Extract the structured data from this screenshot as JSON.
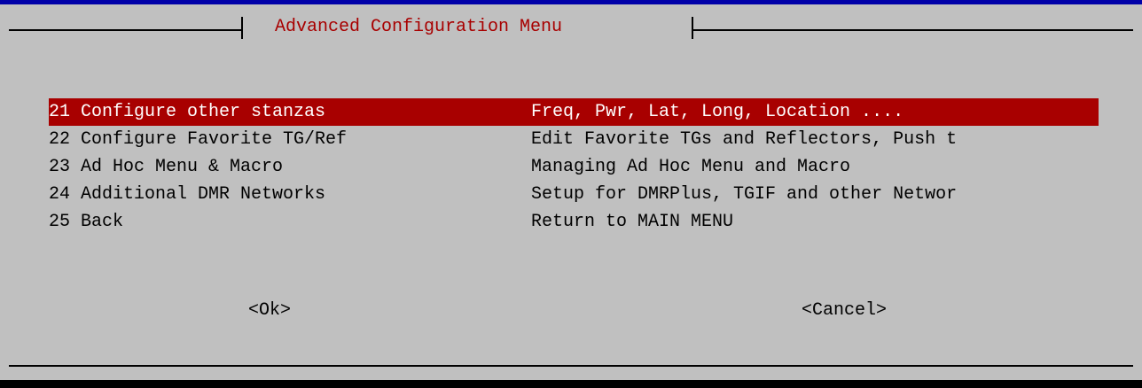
{
  "dialog": {
    "title": "Advanced Configuration Menu"
  },
  "menu": {
    "items": [
      {
        "tag": "21",
        "label": "Configure other stanzas",
        "description": "Freq, Pwr, Lat, Long, Location ....",
        "selected": true
      },
      {
        "tag": "22",
        "label": "Configure Favorite TG/Ref",
        "description": "Edit Favorite TGs and Reflectors, Push t",
        "selected": false
      },
      {
        "tag": "23",
        "label": "Ad Hoc Menu & Macro",
        "description": "Managing Ad Hoc Menu and Macro",
        "selected": false
      },
      {
        "tag": "24",
        "label": "Additional DMR Networks",
        "description": "Setup for DMRPlus, TGIF and other Networ",
        "selected": false
      },
      {
        "tag": "25",
        "label": "Back",
        "description": "Return to MAIN MENU",
        "selected": false
      }
    ]
  },
  "buttons": {
    "ok": "<Ok>",
    "cancel": "<Cancel>"
  },
  "colors": {
    "dialog_background": "#c0c0c0",
    "title_text": "#a80000",
    "selection_background": "#a80000",
    "selection_text": "#ffffff",
    "screen_background": "#000000",
    "top_strip": "#0000a8"
  }
}
